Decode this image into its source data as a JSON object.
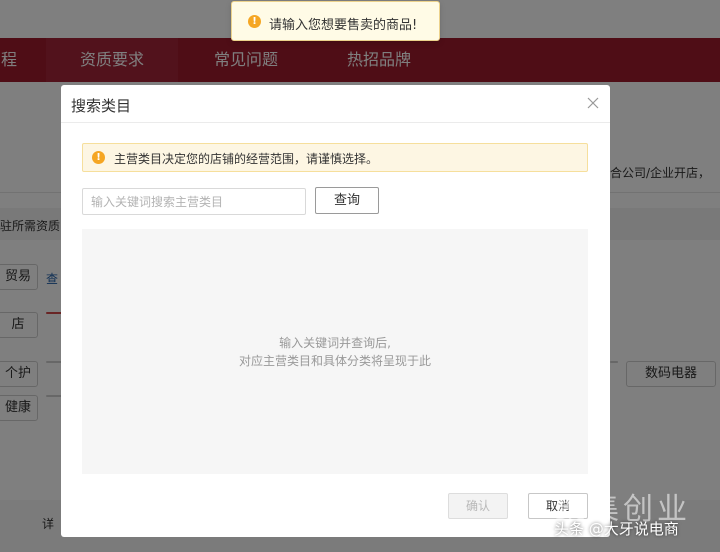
{
  "colors": {
    "nav_background": "#9e1b2c",
    "overlay": "rgba(0,0,0,0.5)",
    "warning_icon": "#f5a623",
    "alert_background": "#fdf6e3"
  },
  "background_page": {
    "nav": {
      "items": [
        {
          "label": "程"
        },
        {
          "label": "资质要求",
          "active": true
        },
        {
          "label": "常见问题"
        },
        {
          "label": "热招品牌"
        }
      ]
    },
    "right_text": "合公司/企业开店，",
    "section_label": "驻所需资质",
    "left_tags": [
      "贸易",
      "店",
      "个护",
      "健康"
    ],
    "link_text": "查",
    "right_tag": "数码电器",
    "table_header": "详"
  },
  "toast": {
    "icon": "warning-icon",
    "message": "请输入您想要售卖的商品!"
  },
  "modal": {
    "title": "搜索类目",
    "close_icon": "close-icon",
    "notice": {
      "icon": "warning-icon",
      "text": "主营类目决定您的店铺的经营范围，请谨慎选择。"
    },
    "search": {
      "placeholder": "输入关键词搜索主营类目",
      "value": "",
      "button_label": "查询"
    },
    "empty_state": {
      "line1": "输入关键词并查询后,",
      "line2": "对应主营类目和具体分类将呈现于此"
    },
    "footer": {
      "confirm_label": "确认",
      "cancel_label": "取消"
    }
  },
  "watermark": {
    "big": "聚集创业",
    "small": "头条 @大牙说电商"
  }
}
